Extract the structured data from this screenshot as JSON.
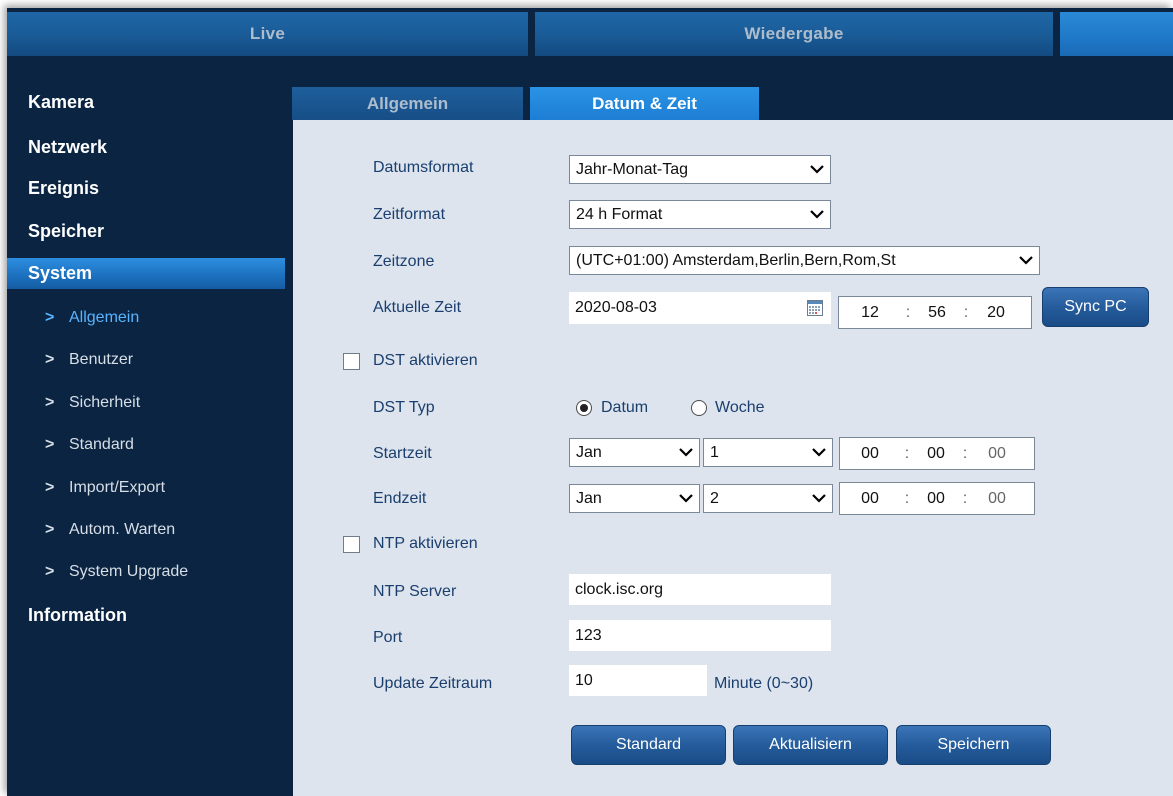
{
  "topnav": {
    "tabs": [
      {
        "label": "Live"
      },
      {
        "label": "Wiedergabe"
      },
      {
        "label": ""
      }
    ]
  },
  "sidebar": {
    "items": [
      {
        "label": "Kamera"
      },
      {
        "label": "Netzwerk"
      },
      {
        "label": "Ereignis"
      },
      {
        "label": "Speicher"
      },
      {
        "label": "System"
      },
      {
        "label": "Information"
      }
    ],
    "system_sub": [
      {
        "label": "Allgemein"
      },
      {
        "label": "Benutzer"
      },
      {
        "label": "Sicherheit"
      },
      {
        "label": "Standard"
      },
      {
        "label": "Import/Export"
      },
      {
        "label": "Autom. Warten"
      },
      {
        "label": "System Upgrade"
      }
    ]
  },
  "subtabs": [
    {
      "label": "Allgemein"
    },
    {
      "label": "Datum & Zeit"
    }
  ],
  "form": {
    "date_format": {
      "label": "Datumsformat",
      "value": "Jahr-Monat-Tag"
    },
    "time_format": {
      "label": "Zeitformat",
      "value": "24 h Format"
    },
    "timezone": {
      "label": "Zeitzone",
      "value": "(UTC+01:00) Amsterdam,Berlin,Bern,Rom,St"
    },
    "current_time": {
      "label": "Aktuelle Zeit",
      "date": "2020-08-03",
      "hour": "12",
      "minute": "56",
      "second": "20",
      "sync_label": "Sync PC"
    },
    "dst_enable": {
      "label": "DST aktivieren",
      "checked": false
    },
    "dst_type": {
      "label": "DST Typ",
      "opt_date": "Datum",
      "opt_week": "Woche",
      "selected": "Datum"
    },
    "start_time": {
      "label": "Startzeit",
      "month": "Jan",
      "day": "1",
      "hour": "00",
      "minute": "00",
      "second": "00"
    },
    "end_time": {
      "label": "Endzeit",
      "month": "Jan",
      "day": "2",
      "hour": "00",
      "minute": "00",
      "second": "00"
    },
    "ntp_enable": {
      "label": "NTP aktivieren",
      "checked": false
    },
    "ntp_server": {
      "label": "NTP Server",
      "value": "clock.isc.org"
    },
    "port": {
      "label": "Port",
      "value": "123"
    },
    "update_period": {
      "label": "Update Zeitraum",
      "value": "10",
      "unit": "Minute (0~30)"
    }
  },
  "buttons": {
    "standard": "Standard",
    "refresh": "Aktualisiern",
    "save": "Speichern"
  },
  "separator": ":"
}
